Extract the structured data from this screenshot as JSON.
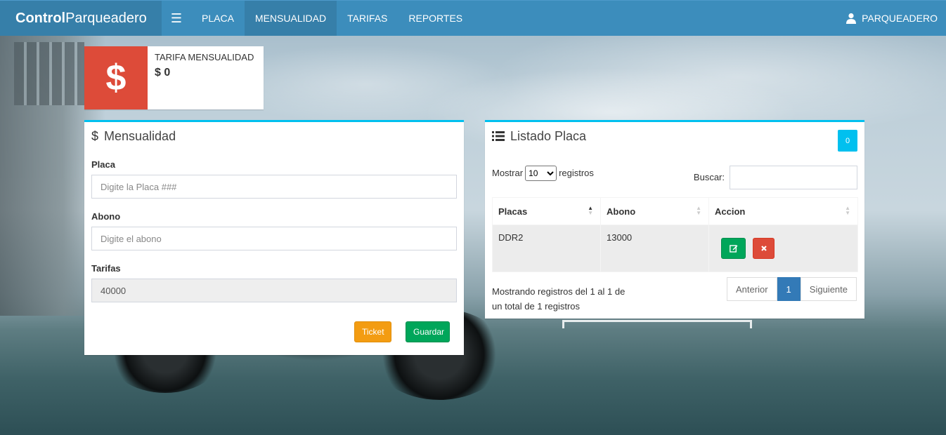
{
  "navbar": {
    "brand_bold": "Control",
    "brand_rest": "Parqueadero",
    "menu_toggle_icon": "hamburger-icon",
    "items": [
      "PLACA",
      "MENSUALIDAD",
      "TARIFAS",
      "REPORTES"
    ],
    "active_item": "MENSUALIDAD",
    "user_icon": "user-icon",
    "user_label": "PARQUEADERO"
  },
  "info_box": {
    "icon": "dollar-icon",
    "icon_glyph": "$",
    "label": "TARIFA MENSUALIDAD",
    "value": "$ 0",
    "color": "#dd4b39"
  },
  "form_box": {
    "icon": "dollar-icon",
    "icon_glyph": "$",
    "title": "Mensualidad",
    "placa_label": "Placa",
    "placa_placeholder": "Digite la Placa ###",
    "abono_label": "Abono",
    "abono_placeholder": "Digite el abono",
    "tarifas_label": "Tarifas",
    "tarifas_value": "40000",
    "ticket_button": "Ticket",
    "guardar_button": "Guardar"
  },
  "list_box": {
    "icon": "list-icon",
    "title": "Listado Placa",
    "count_badge": "0",
    "show_label": "Mostrar",
    "show_value": "10",
    "show_options": [
      "10"
    ],
    "records_label": "registros",
    "search_label": "Buscar:",
    "columns": [
      "Placas",
      "Abono",
      "Accion"
    ],
    "rows": [
      {
        "placa": "DDR2",
        "abono": "13000"
      }
    ],
    "info_line1": "Mostrando registros del 1 al 1 de",
    "info_line2": "un total de 1 registros",
    "prev_label": "Anterior",
    "current_page": "1",
    "next_label": "Siguiente"
  },
  "colors": {
    "navbar": "#3c8dbc",
    "brand_bg": "#367fa9",
    "box_border": "#00c0ef",
    "warning": "#f39c12",
    "success": "#00a65a",
    "danger": "#dd4b39",
    "pager_active": "#337ab7"
  }
}
